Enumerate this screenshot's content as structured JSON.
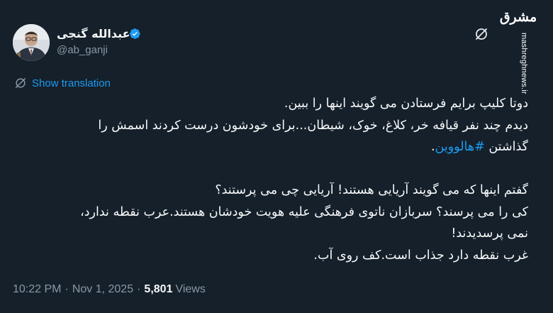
{
  "author": {
    "display_name": "عبدالله گنجی",
    "handle": "@ab_ganji"
  },
  "watermark": {
    "logo_text": "مشرق",
    "url": "mashreghnews.ir"
  },
  "translate": {
    "label": "Show translation"
  },
  "tweet": {
    "lines": [
      "دوتا کلیپ برایم فرستادن می گویند اینها را ببین.",
      "دیدم چند نفر قیافه خر، کلاغ، خوک، شیطان...برای خودشون درست کردند اسمش را",
      "گذاشتن",
      "#هالووین",
      ".",
      "گفتم اینها که می گویند آریایی هستند! آریایی چی می پرستند؟",
      "کی را می پرسند؟ سربازان ناتوی فرهنگی علیه هویت خودشان هستند.عرب نقطه ندارد،",
      "نمی پرسدیدند!",
      "غرب نقطه دارد جذاب است.کف روی آب."
    ]
  },
  "meta": {
    "time": "10:22 PM",
    "separator": "·",
    "date": "Nov 1, 2025",
    "views_count": "5,801",
    "views_label": "Views"
  },
  "colors": {
    "background": "#15202b",
    "text": "#f7f9f9",
    "secondary": "#8b98a5",
    "accent": "#1d9bf0"
  },
  "icons": {
    "verified": "verified-badge-icon",
    "grok": "grok-icon",
    "translate": "translate-icon"
  }
}
